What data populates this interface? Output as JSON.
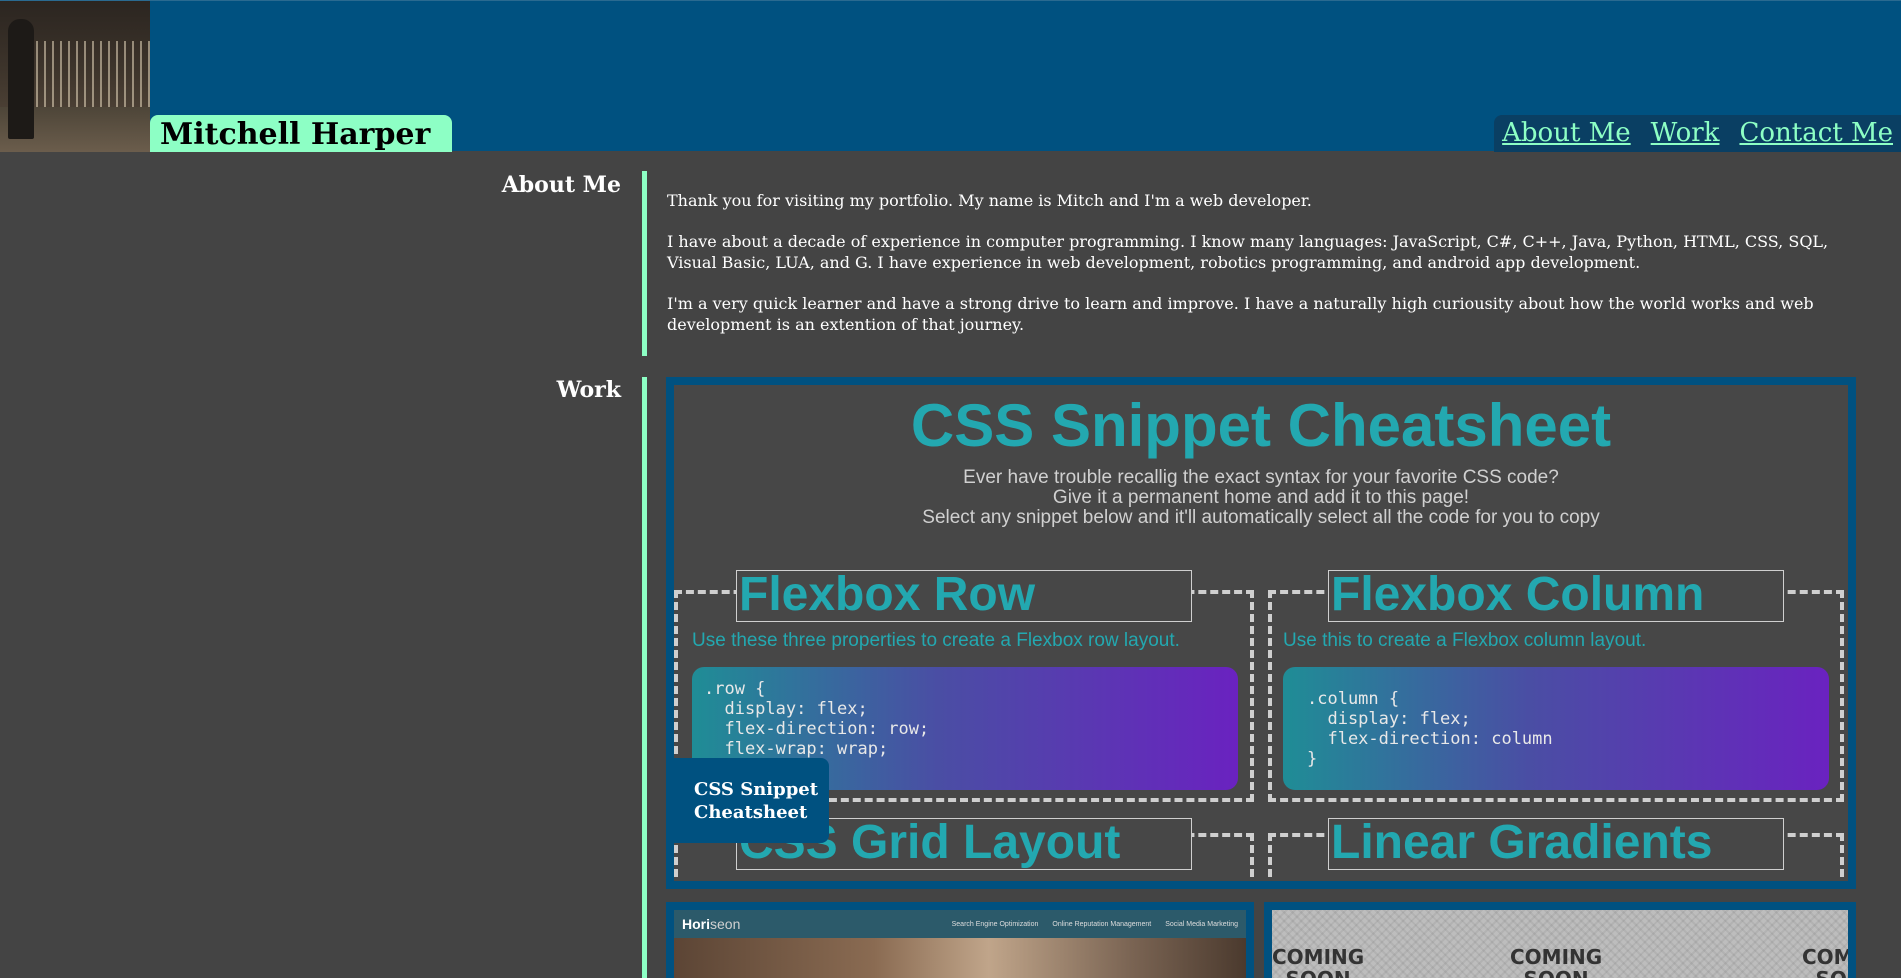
{
  "header": {
    "name": "Mitchell Harper",
    "nav": [
      "About Me",
      "Work",
      "Contact Me"
    ]
  },
  "about": {
    "heading": "About Me",
    "paragraphs": [
      "Thank you for visiting my portfolio. My name is Mitch and I'm a web developer.",
      "I have about a decade of experience in computer programming. I know many languages: JavaScript, C#, C++, Java, Python, HTML, CSS, SQL, Visual Basic, LUA, and G. I have experience in web development, robotics programming, and android app development.",
      "I'm a very quick learner and have a strong drive to learn and improve. I have a naturally high curiousity about how the world works and web development is an extention of that journey."
    ]
  },
  "work": {
    "heading": "Work",
    "featured": {
      "label": "CSS Snippet Cheatsheet",
      "title": "CSS Snippet Cheatsheet",
      "subtitle": [
        "Ever have trouble recallig the exact syntax for your favorite CSS code?",
        "Give it a permanent home and add it to this page!",
        "Select any snippet below and it'll automatically select all the code for you to copy"
      ],
      "boxes": [
        {
          "title": "Flexbox Row",
          "desc": "Use these three properties to create a Flexbox row layout.",
          "code": ".row {\n  display: flex;\n  flex-direction: row;\n  flex-wrap: wrap;\n}"
        },
        {
          "title": "Flexbox Column",
          "desc": "Use this to create a Flexbox column layout.",
          "code": ".column {\n  display: flex;\n  flex-direction: column\n}"
        },
        {
          "title": "CSS Grid Layout",
          "desc": "",
          "code": ""
        },
        {
          "title": "Linear Gradients",
          "desc": "",
          "code": ""
        }
      ]
    },
    "thumb1": {
      "brand_a": "Hori",
      "brand_b": "seon",
      "links": [
        "Search Engine Optimization",
        "Online Reputation Management",
        "Social Media Marketing"
      ]
    },
    "thumb2": {
      "text1": "COMING",
      "text2": "SOON"
    }
  }
}
